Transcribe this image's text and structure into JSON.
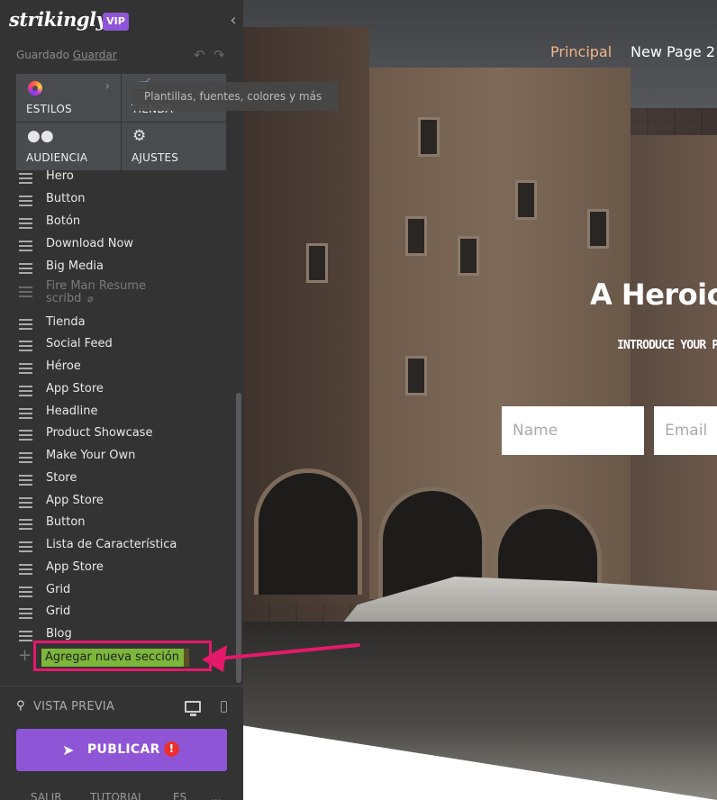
{
  "sidebar": {
    "logo": "strikingly",
    "vip_badge": "VIP",
    "save_status": "Guardado",
    "save_link": "Guardar",
    "tiles": [
      {
        "label": "ESTILOS",
        "icon": "palette-icon"
      },
      {
        "label": "TIENDA",
        "icon": "bag-icon"
      },
      {
        "label": "AUDIENCIA",
        "icon": "people-icon"
      },
      {
        "label": "AJUSTES",
        "icon": "gear-icon"
      }
    ],
    "tooltip": "Plantillas, fuentes, colores y más",
    "sections": [
      "Hero",
      "Button",
      "Botón",
      "Download Now",
      "Big Media",
      "Fire Man Resume scribd",
      "Tienda",
      "Social Feed",
      "Héroe",
      "App Store",
      "Headline",
      "Product Showcase",
      "Make Your Own",
      "Store",
      "App Store",
      "Button",
      "Lista de Característica",
      "App Store",
      "Grid",
      "Grid",
      "Blog"
    ],
    "add_section": "Agregar nueva sección",
    "preview_label": "VISTA PREVIA",
    "publish_label": "PUBLICAR",
    "publish_alert": "!",
    "footer": [
      "SALIR",
      "TUTORIAL",
      "ES",
      "..."
    ]
  },
  "canvas": {
    "nav": [
      "Principal",
      "New Page 2"
    ],
    "hero_title": "A Heroic",
    "hero_subtitle": "INTRODUCE YOUR P",
    "name_placeholder": "Name",
    "email_placeholder": "Email"
  },
  "colors": {
    "sidebar_bg": "#333334",
    "tile_bg": "#4a4b4e",
    "brand_purple": "#8e55d6",
    "highlight_pink": "#e5196a",
    "add_green": "#7cb63a",
    "nav_active": "#f4b58a"
  }
}
